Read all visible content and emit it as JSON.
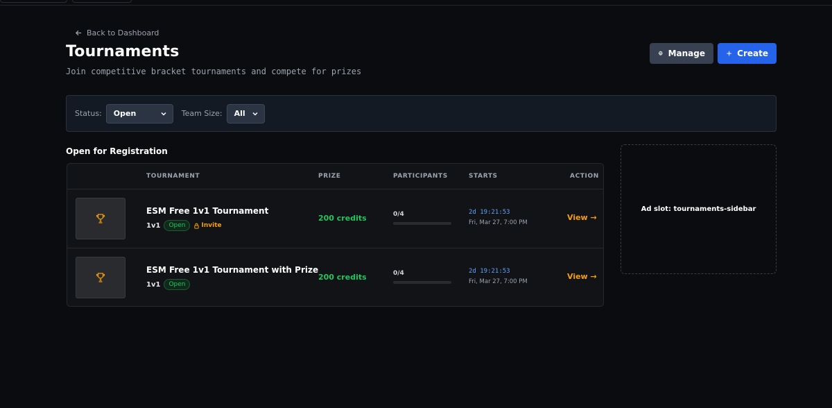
{
  "nav": {
    "back_label": "Back to Dashboard"
  },
  "header": {
    "title": "Tournaments",
    "subtitle": "Join competitive bracket tournaments and compete for prizes",
    "manage_label": "Manage",
    "create_label": "Create"
  },
  "filters": {
    "status_label": "Status:",
    "status_value": "Open",
    "team_size_label": "Team Size:",
    "team_size_value": "All"
  },
  "section": {
    "title": "Open for Registration"
  },
  "table": {
    "columns": [
      "TOURNAMENT",
      "PRIZE",
      "PARTICIPANTS",
      "STARTS",
      "ACTION"
    ],
    "rows": [
      {
        "name": "ESM Free 1v1 Tournament",
        "size": "1v1",
        "status": "Open",
        "invite": "Invite",
        "prize": "200 credits",
        "participants": "0/4",
        "participants_fraction": 0,
        "countdown": "2d 19:21:53",
        "date": "Fri, Mar 27, 7:00 PM",
        "action": "View →"
      },
      {
        "name": "ESM Free 1v1 Tournament with Prize",
        "size": "1v1",
        "status": "Open",
        "prize": "200 credits",
        "participants": "0/4",
        "participants_fraction": 0,
        "countdown": "2d 19:21:53",
        "date": "Fri, Mar 27, 7:00 PM",
        "action": "View →"
      }
    ]
  },
  "ad": {
    "label": "Ad slot: tournaments-sidebar"
  },
  "colors": {
    "background": "#0b0c0f",
    "accent_blue": "#2563eb",
    "success_green": "#22c55e",
    "warning_amber": "#f59e0b",
    "countdown_blue": "#60a5fa"
  },
  "icons": {
    "back": "arrow-left-icon",
    "manage": "gear-icon",
    "create": "plus-icon",
    "thumbnail": "trophy-icon",
    "invite": "lock-icon",
    "select": "chevron-down-icon"
  }
}
